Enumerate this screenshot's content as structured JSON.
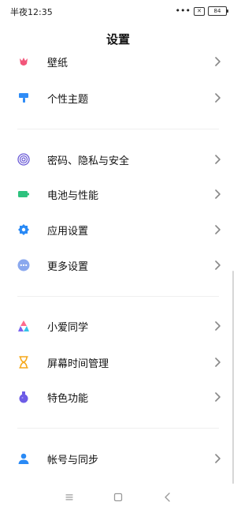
{
  "status_bar": {
    "time": "半夜12:35",
    "dots": "•••",
    "sim": "✕",
    "battery": "84"
  },
  "page": {
    "title": "设置"
  },
  "items": [
    {
      "label": "壁纸",
      "icon": "wallpaper-icon"
    },
    {
      "label": "个性主题",
      "icon": "theme-brush-icon"
    },
    {
      "label": "密码、隐私与安全",
      "icon": "fingerprint-icon"
    },
    {
      "label": "电池与性能",
      "icon": "battery-icon"
    },
    {
      "label": "应用设置",
      "icon": "app-settings-gear-icon"
    },
    {
      "label": "更多设置",
      "icon": "more-dots-icon"
    },
    {
      "label": "小爱同学",
      "icon": "xiaoai-icon"
    },
    {
      "label": "屏幕时间管理",
      "icon": "hourglass-icon"
    },
    {
      "label": "特色功能",
      "icon": "potion-icon"
    },
    {
      "label": "帐号与同步",
      "icon": "account-person-icon"
    }
  ],
  "colors": {
    "wallpaper": "#f2557a",
    "theme": "#2f8cf6",
    "fingerprint": "#6a5ad6",
    "battery": "#2ec27e",
    "app_settings": "#2a8af5",
    "more": "#8aa8ee",
    "hourglass": "#f6a91c",
    "potion": "#6d5ce6",
    "account": "#2a8af5"
  }
}
